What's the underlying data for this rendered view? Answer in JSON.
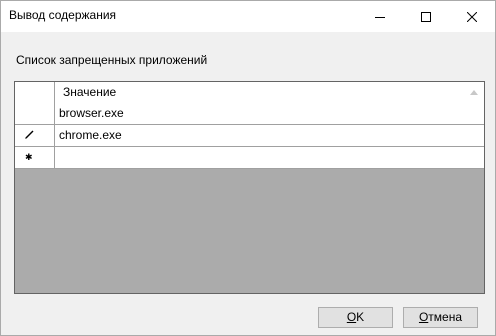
{
  "window": {
    "title": "Вывод содержания",
    "controls": {
      "minimize_icon": "minimize-icon",
      "maximize_icon": "maximize-icon",
      "close_icon": "close-icon"
    }
  },
  "section_label": "Список запрещенных приложений",
  "grid": {
    "column_header": "Значение",
    "rows": [
      {
        "value": "browser.exe",
        "indicator": ""
      },
      {
        "value": "chrome.exe",
        "indicator": "pencil-icon"
      },
      {
        "value": "",
        "indicator": "new-row-icon"
      }
    ]
  },
  "buttons": {
    "ok": {
      "accel": "O",
      "rest": "K"
    },
    "cancel": {
      "accel": "О",
      "rest": "тмена"
    }
  },
  "colors": {
    "window_bg": "#f0f0f0",
    "grid_bg": "#ababab",
    "button_bg": "#e1e1e1"
  }
}
